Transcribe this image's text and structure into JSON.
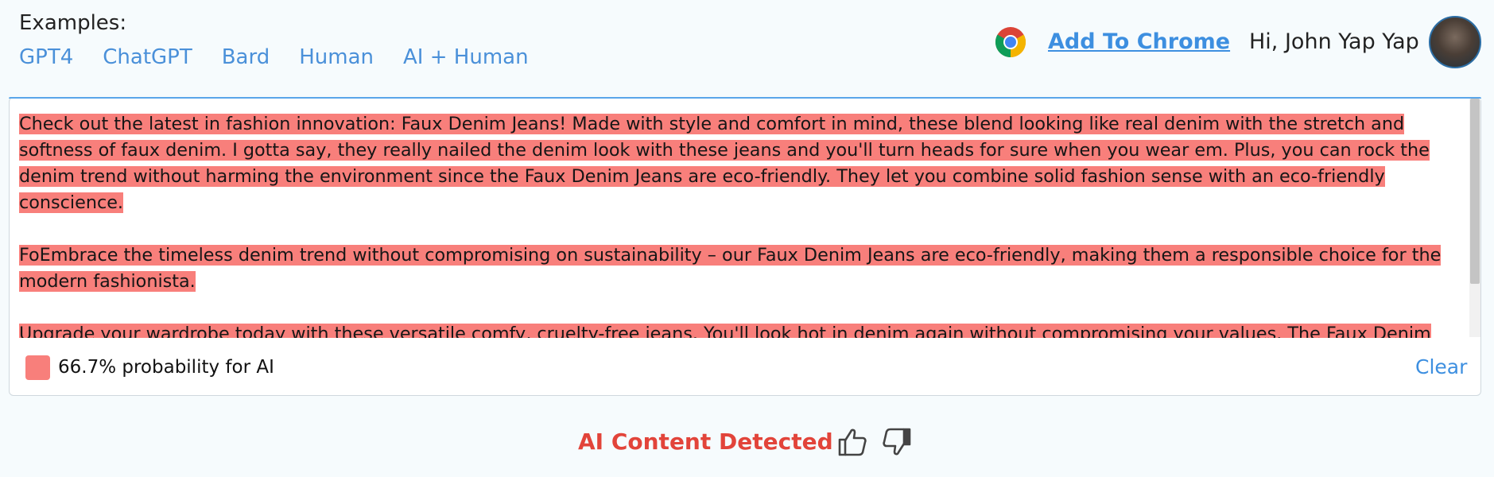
{
  "examples": {
    "title": "Examples:",
    "links": [
      "GPT4",
      "ChatGPT",
      "Bard",
      "Human",
      "AI + Human"
    ]
  },
  "header": {
    "add_to_chrome": "Add To Chrome",
    "greeting": "Hi, John Yap Yap",
    "chrome_icon": "chrome-logo-icon",
    "avatar": "user-avatar"
  },
  "editor": {
    "paragraphs": [
      "Check out the latest in fashion innovation: Faux Denim Jeans! Made with style and comfort in mind, these blend looking like real denim with the stretch and softness of faux denim.  I gotta say, they really nailed the denim look with these jeans and  you'll turn heads for sure when you wear em.  Plus, you can rock the denim trend without harming the environment since the Faux Denim Jeans are eco-friendly.  They let you combine solid fashion sense with an eco-friendly conscience. ",
      "FoEmbrace the timeless denim trend without compromising on sustainability – our Faux Denim Jeans are eco-friendly, making them a responsible choice for the modern fashionista. ",
      "Upgrade your wardrobe today with these versatile comfy, cruelty-free jeans.  You'll look hot in denim again without compromising your values.  The Faux Denim Jeans let you discover the beauty of faux denim."
    ],
    "highlight_color": "#f87f7b"
  },
  "footer": {
    "probability_text": "66.7% probability for AI",
    "clear_label": "Clear"
  },
  "result": {
    "label": "AI Content Detected",
    "label_color": "#e2443a"
  },
  "colors": {
    "accent": "#3d8fe0",
    "link": "#4a90d9"
  }
}
